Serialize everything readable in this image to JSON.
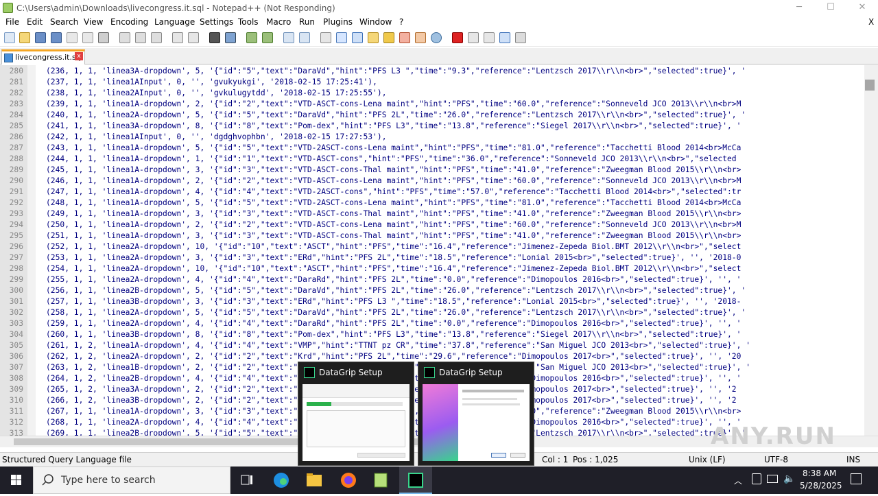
{
  "window": {
    "title": "C:\\Users\\admin\\Downloads\\livecongress.it.sql - Notepad++ (Not Responding)",
    "minimize": "─",
    "maximize": "☐",
    "close": "✕",
    "doc_close": "X"
  },
  "menu": [
    "File",
    "Edit",
    "Search",
    "View",
    "Encoding",
    "Language",
    "Settings",
    "Tools",
    "Macro",
    "Run",
    "Plugins",
    "Window",
    "?"
  ],
  "tab": {
    "label": "livecongress.it.sql",
    "close": "x"
  },
  "lines": [
    {
      "n": "280",
      "code": "(236, 1, 1, 'linea3A-dropdown', 5, '{\"id\":\"5\",\"text\":\"DaraVd\",\"hint\":\"PFS L3 \",\"time\":\"9.3\",\"reference\":\"Lentzsch 2017\\\\r\\\\n<br>\",\"selected\":true}', '"
    },
    {
      "n": "281",
      "code": "(237, 1, 1, 'linea1AInput', 0, '', 'gvukyukgi', '2018-02-15 17:25:41'),"
    },
    {
      "n": "282",
      "code": "(238, 1, 1, 'linea2AInput', 0, '', 'gvkulugytdd', '2018-02-15 17:25:55'),"
    },
    {
      "n": "283",
      "code": "(239, 1, 1, 'linea1A-dropdown', 2, '{\"id\":\"2\",\"text\":\"VTD-ASCT-cons-Lena maint\",\"hint\":\"PFS\",\"time\":\"60.0\",\"reference\":\"Sonneveld JCO 2013\\\\r\\\\n<br>M"
    },
    {
      "n": "284",
      "code": "(240, 1, 1, 'linea2A-dropdown', 5, '{\"id\":\"5\",\"text\":\"DaraVd\",\"hint\":\"PFS 2L\",\"time\":\"26.0\",\"reference\":\"Lentzsch 2017\\\\r\\\\n<br>\",\"selected\":true}', '"
    },
    {
      "n": "285",
      "code": "(241, 1, 1, 'linea3A-dropdown', 8, '{\"id\":\"8\",\"text\":\"Pom-dex\",\"hint\":\"PFS L3\",\"time\":\"13.8\",\"reference\":\"Siegel 2017\\\\r\\\\n<br>\",\"selected\":true}', '"
    },
    {
      "n": "286",
      "code": "(242, 1, 1, 'linea1AInput', 0, '', 'dgdghvophbn', '2018-02-15 17:27:53'),"
    },
    {
      "n": "287",
      "code": "(243, 1, 1, 'linea1A-dropdown', 5, '{\"id\":\"5\",\"text\":\"VTD-2ASCT-cons-Lena maint\",\"hint\":\"PFS\",\"time\":\"81.0\",\"reference\":\"Tacchetti Blood 2014<br>McCa"
    },
    {
      "n": "288",
      "code": "(244, 1, 1, 'linea1A-dropdown', 1, '{\"id\":\"1\",\"text\":\"VTD-ASCT-cons\",\"hint\":\"PFS\",\"time\":\"36.0\",\"reference\":\"Sonneveld JCO 2013\\\\r\\\\n<br>\",\"selected"
    },
    {
      "n": "289",
      "code": "(245, 1, 1, 'linea1A-dropdown', 3, '{\"id\":\"3\",\"text\":\"VTD-ASCT-cons-Thal maint\",\"hint\":\"PFS\",\"time\":\"41.0\",\"reference\":\"Zweegman Blood 2015\\\\r\\\\n<br>"
    },
    {
      "n": "290",
      "code": "(246, 1, 1, 'linea1A-dropdown', 2, '{\"id\":\"2\",\"text\":\"VTD-ASCT-cons-Lena maint\",\"hint\":\"PFS\",\"time\":\"60.0\",\"reference\":\"Sonneveld JCO 2013\\\\r\\\\n<br>M"
    },
    {
      "n": "291",
      "code": "(247, 1, 1, 'linea1A-dropdown', 4, '{\"id\":\"4\",\"text\":\"VTD-2ASCT-cons\",\"hint\":\"PFS\",\"time\":\"57.0\",\"reference\":\"Tacchetti Blood 2014<br>\",\"selected\":tr"
    },
    {
      "n": "292",
      "code": "(248, 1, 1, 'linea1A-dropdown', 5, '{\"id\":\"5\",\"text\":\"VTD-2ASCT-cons-Lena maint\",\"hint\":\"PFS\",\"time\":\"81.0\",\"reference\":\"Tacchetti Blood 2014<br>McCa"
    },
    {
      "n": "293",
      "code": "(249, 1, 1, 'linea1A-dropdown', 3, '{\"id\":\"3\",\"text\":\"VTD-ASCT-cons-Thal maint\",\"hint\":\"PFS\",\"time\":\"41.0\",\"reference\":\"Zweegman Blood 2015\\\\r\\\\n<br>"
    },
    {
      "n": "294",
      "code": "(250, 1, 1, 'linea1A-dropdown', 2, '{\"id\":\"2\",\"text\":\"VTD-ASCT-cons-Lena maint\",\"hint\":\"PFS\",\"time\":\"60.0\",\"reference\":\"Sonneveld JCO 2013\\\\r\\\\n<br>M"
    },
    {
      "n": "295",
      "code": "(251, 1, 1, 'linea1A-dropdown', 3, '{\"id\":\"3\",\"text\":\"VTD-ASCT-cons-Thal maint\",\"hint\":\"PFS\",\"time\":\"41.0\",\"reference\":\"Zweegman Blood 2015\\\\r\\\\n<br>"
    },
    {
      "n": "296",
      "code": "(252, 1, 1, 'linea2A-dropdown', 10, '{\"id\":\"10\",\"text\":\"ASCT\",\"hint\":\"PFS\",\"time\":\"16.4\",\"reference\":\"Jimenez-Zepeda Biol.BMT 2012\\\\r\\\\n<br>\",\"select"
    },
    {
      "n": "297",
      "code": "(253, 1, 1, 'linea2A-dropdown', 3, '{\"id\":\"3\",\"text\":\"ERd\",\"hint\":\"PFS 2L\",\"time\":\"18.5\",\"reference\":\"Lonial 2015<br>\",\"selected\":true}', '', '2018-0"
    },
    {
      "n": "298",
      "code": "(254, 1, 1, 'linea2A-dropdown', 10, '{\"id\":\"10\",\"text\":\"ASCT\",\"hint\":\"PFS\",\"time\":\"16.4\",\"reference\":\"Jimenez-Zepeda Biol.BMT 2012\\\\r\\\\n<br>\",\"select"
    },
    {
      "n": "299",
      "code": "(255, 1, 1, 'linea2A-dropdown', 4, '{\"id\":\"4\",\"text\":\"DaraRd\",\"hint\":\"PFS 2L\",\"time\":\"0.0\",\"reference\":\"Dimopoulos 2016<br>\",\"selected\":true}', '', '"
    },
    {
      "n": "300",
      "code": "(256, 1, 1, 'linea2B-dropdown', 5, '{\"id\":\"5\",\"text\":\"DaraVd\",\"hint\":\"PFS 2L\",\"time\":\"26.0\",\"reference\":\"Lentzsch 2017\\\\r\\\\n<br>\",\"selected\":true}', '"
    },
    {
      "n": "301",
      "code": "(257, 1, 1, 'linea3B-dropdown', 3, '{\"id\":\"3\",\"text\":\"ERd\",\"hint\":\"PFS L3 \",\"time\":\"18.5\",\"reference\":\"Lonial 2015<br>\",\"selected\":true}', '', '2018-"
    },
    {
      "n": "302",
      "code": "(258, 1, 1, 'linea2A-dropdown', 5, '{\"id\":\"5\",\"text\":\"DaraVd\",\"hint\":\"PFS 2L\",\"time\":\"26.0\",\"reference\":\"Lentzsch 2017\\\\r\\\\n<br>\",\"selected\":true}', '"
    },
    {
      "n": "303",
      "code": "(259, 1, 1, 'linea2A-dropdown', 4, '{\"id\":\"4\",\"text\":\"DaraRd\",\"hint\":\"PFS 2L\",\"time\":\"0.0\",\"reference\":\"Dimopoulos 2016<br>\",\"selected\":true}', '', '"
    },
    {
      "n": "304",
      "code": "(260, 1, 1, 'linea3B-dropdown', 8, '{\"id\":\"8\",\"text\":\"Pom-dex\",\"hint\":\"PFS L3\",\"time\":\"13.8\",\"reference\":\"Siegel 2017\\\\r\\\\n<br>\",\"selected\":true}', '"
    },
    {
      "n": "305",
      "code": "(261, 1, 2, 'linea1A-dropdown', 4, '{\"id\":\"4\",\"text\":\"VMP\",\"hint\":\"TTNT pz CR\",\"time\":\"37.8\",\"reference\":\"San Miguel JCO 2013<br>\",\"selected\":true}', '"
    },
    {
      "n": "306",
      "code": "(262, 1, 2, 'linea2A-dropdown', 2, '{\"id\":\"2\",\"text\":\"Krd\",\"hint\":\"PFS 2L\",\"time\":\"29.6\",\"reference\":\"Dimopoulos 2017<br>\",\"selected\":true}', '', '20"
    },
    {
      "n": "307",
      "code": "(263, 1, 2, 'linea1B-dropdown', 2, '{\"id\":\"2\",\"text\":\"VMP\",\"hint\":\"TTNT pz CR\",\"time\":\"35.5\",\"reference\":\"San Miguel JCO 2013<br>\",\"selected\":true}', '"
    },
    {
      "n": "308",
      "code": "(264, 1, 2, 'linea2B-dropdown', 4, '{\"id\":\"4\",\"text\":\"DaraRd\",\"hint\":\"PFS 2L\",\"time\":\"0.0\",\"reference\":\"Dimopoulos 2016<br>\",\"selected\":true}', '', '"
    },
    {
      "n": "309",
      "code": "(265, 1, 2, 'linea3A-dropdown', 2, '{\"id\":\"2\",\"text\":\"Krd\",\"hint\":\"PFS 2L\",\"time\":\"29.6\",\"reference\":\"Dimopoulos 2017<br>\",\"selected\":true}', '', '2"
    },
    {
      "n": "310",
      "code": "(266, 1, 2, 'linea3B-dropdown', 2, '{\"id\":\"2\",\"text\":\"Krd\",\"hint\":\"PFS 2L\",\"time\":\"29.6\",\"reference\":\"Dimopoulos 2017<br>\",\"selected\":true}', '', '2"
    },
    {
      "n": "311",
      "code": "(267, 1, 1, 'linea1A-dropdown', 3, '{\"id\":\"3\",\"text\":\"VTD-ASCT-cons-Thal maint\",\"hint\":\"PFS\",\"time\":\"41.0\",\"reference\":\"Zweegman Blood 2015\\\\r\\\\n<br>"
    },
    {
      "n": "312",
      "code": "(268, 1, 1, 'linea2A-dropdown', 4, '{\"id\":\"4\",\"text\":\"DaraRd\",\"hint\":\"PFS 2L\",\"time\":\"0.0\",\"reference\":\"Dimopoulos 2016<br>\",\"selected\":true}', '', '"
    },
    {
      "n": "313",
      "code": "(269, 1, 1, 'linea2B-dropdown', 5, '{\"id\":\"5\",\"text\":\"DaraVd\",\"hint\":\"PFS 2L\",\"time\":\"26.0\",\"reference\":\"Lentzsch 2017\\\\r\\\\n<br>\",\"selected\":true}', '"
    }
  ],
  "status": {
    "file_type": "Structured Query Language file",
    "col": "Col : 1",
    "pos": "Pos : 1,025",
    "eol": "Unix (LF)",
    "encoding": "UTF-8",
    "mode": "INS"
  },
  "popups": [
    {
      "title": "DataGrip Setup"
    },
    {
      "title": "DataGrip Setup"
    }
  ],
  "taskbar": {
    "search_placeholder": "Type here to search",
    "time": "8:38 AM",
    "date": "5/28/2025"
  },
  "watermark": "ANY.RUN",
  "colors": {
    "accent_tab": "#f5a623",
    "code_text": "#000080",
    "taskbar": "#1f1f28"
  }
}
